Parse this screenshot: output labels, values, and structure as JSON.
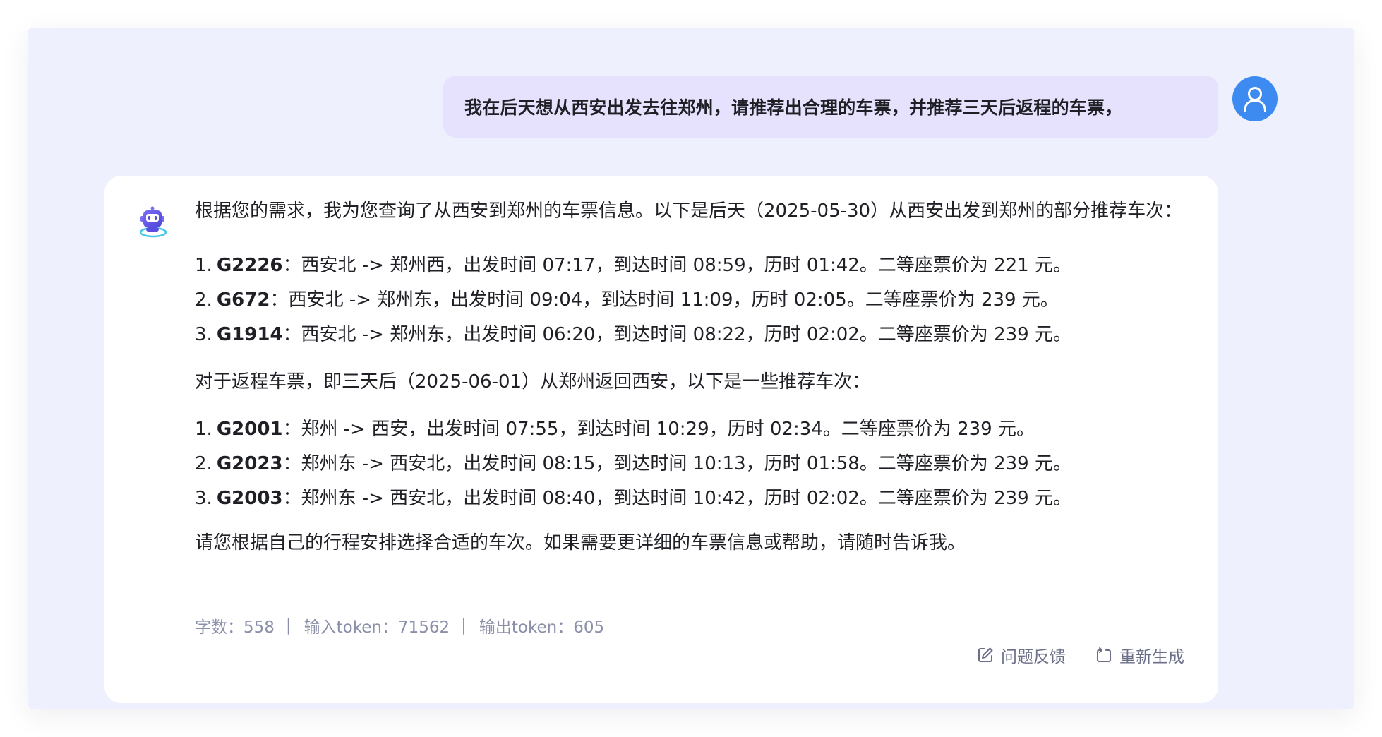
{
  "user_message": {
    "text": "我在后天想从西安出发去往郑州，请推荐出合理的车票，并推荐三天后返程的车票，"
  },
  "assistant": {
    "intro": "根据您的需求，我为您查询了从西安到郑州的车票信息。以下是后天（2025-05-30）从西安出发到郑州的部分推荐车次：",
    "outbound": [
      {
        "num": "1.",
        "code": "G2226",
        "detail": "：西安北 -> 郑州西，出发时间 07:17，到达时间 08:59，历时 01:42。二等座票价为 221 元。"
      },
      {
        "num": "2.",
        "code": "G672",
        "detail": "：西安北 -> 郑州东，出发时间 09:04，到达时间 11:09，历时 02:05。二等座票价为 239 元。"
      },
      {
        "num": "3.",
        "code": "G1914",
        "detail": "：西安北 -> 郑州东，出发时间 06:20，到达时间 08:22，历时 02:02。二等座票价为 239 元。"
      }
    ],
    "return_intro": "对于返程车票，即三天后（2025-06-01）从郑州返回西安，以下是一些推荐车次：",
    "return": [
      {
        "num": "1.",
        "code": "G2001",
        "detail": "：郑州 -> 西安，出发时间 07:55，到达时间 10:29，历时 02:34。二等座票价为 239 元。"
      },
      {
        "num": "2.",
        "code": "G2023",
        "detail": "：郑州东 -> 西安北，出发时间 08:15，到达时间 10:13，历时 01:58。二等座票价为 239 元。"
      },
      {
        "num": "3.",
        "code": "G2003",
        "detail": "：郑州东 -> 西安北，出发时间 08:40，到达时间 10:42，历时 02:02。二等座票价为 239 元。"
      }
    ],
    "closing": "请您根据自己的行程安排选择合适的车次。如果需要更详细的车票信息或帮助，请随时告诉我。",
    "meta": {
      "chars": "字数：558",
      "sep": "|",
      "input_tokens": "输入token：71562",
      "output_tokens": "输出token：605"
    },
    "actions": {
      "feedback": "问题反馈",
      "regenerate": "重新生成"
    }
  },
  "icons": {
    "user_avatar": "user-icon",
    "assistant_avatar": "robot-icon",
    "feedback": "edit-icon",
    "regenerate": "regenerate-icon"
  },
  "colors": {
    "panel_bg": "#eef0fd",
    "user_bubble": "#e6e2fd",
    "avatar_blue": "#3d8bf0",
    "meta_text": "#8b8fa8"
  }
}
